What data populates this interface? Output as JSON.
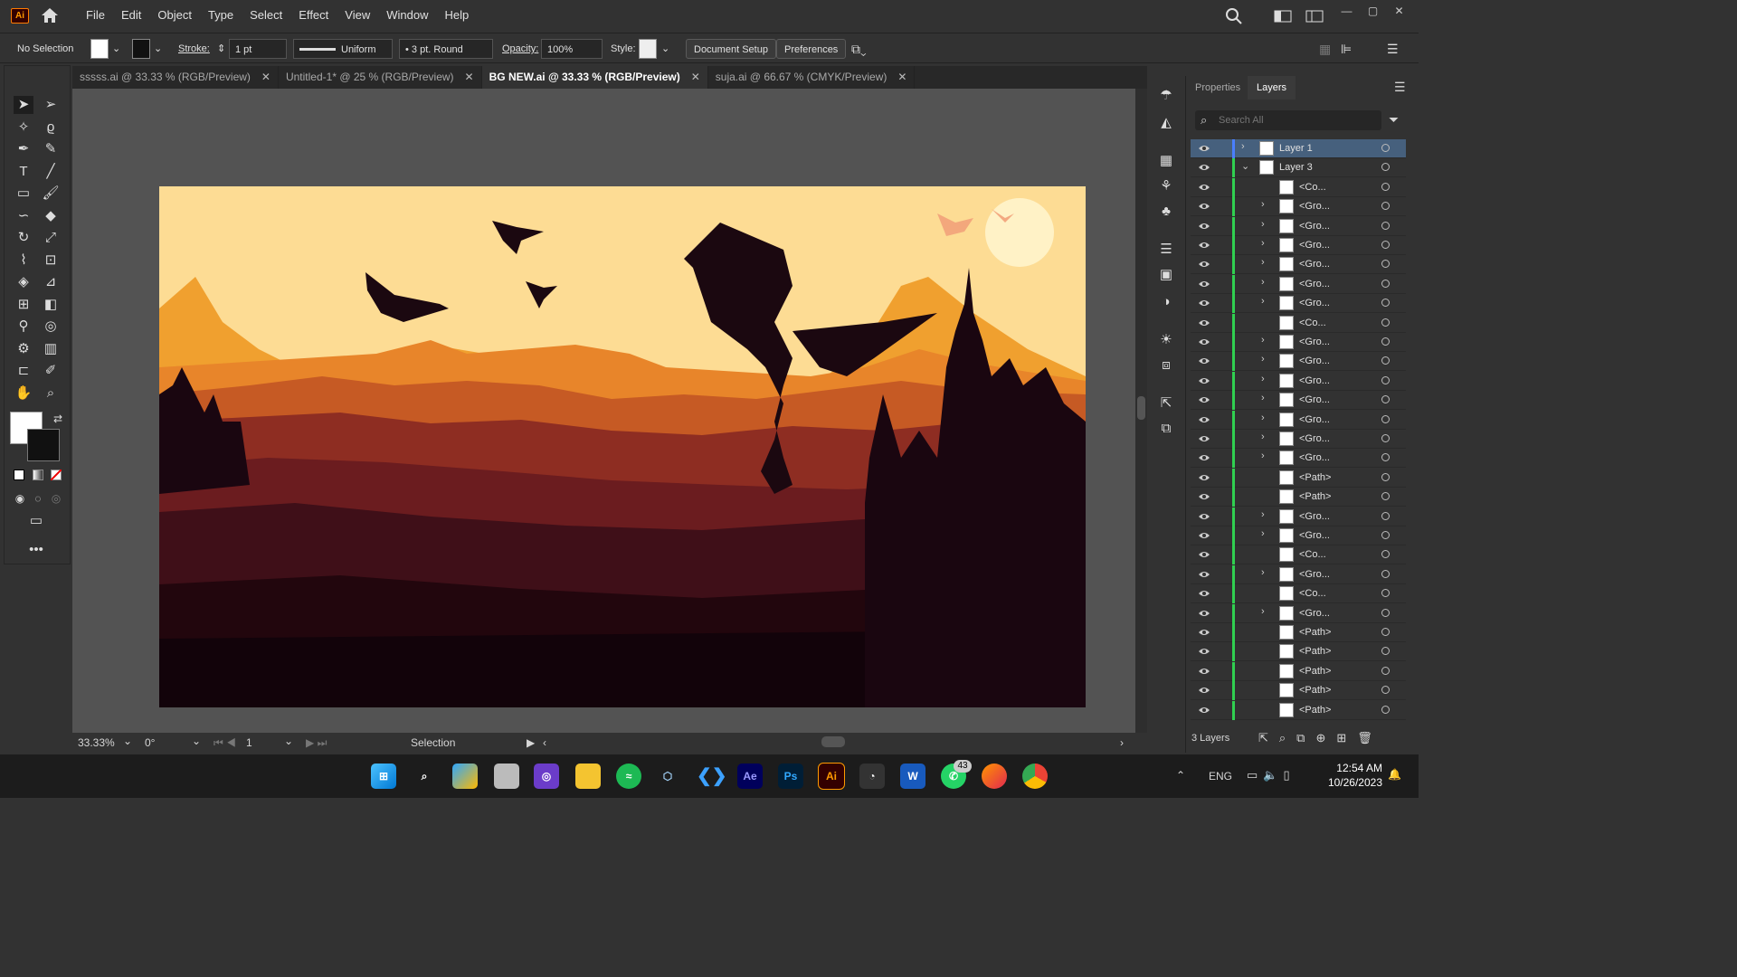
{
  "app": {
    "logo": "Ai",
    "window_controls": [
      "—",
      "▢",
      "✕"
    ]
  },
  "menu": [
    "File",
    "Edit",
    "Object",
    "Type",
    "Select",
    "Effect",
    "View",
    "Window",
    "Help"
  ],
  "control": {
    "selection": "No Selection",
    "stroke_label": "Stroke:",
    "stroke_value": "1 pt",
    "profile": "Uniform",
    "brush": "3 pt. Round",
    "opacity_label": "Opacity:",
    "opacity_value": "100%",
    "style_label": "Style:",
    "doc_setup": "Document Setup",
    "preferences": "Preferences"
  },
  "tabs": [
    {
      "label": "sssss.ai @ 33.33 % (RGB/Preview)",
      "close": "✕"
    },
    {
      "label": "Untitled-1* @ 25 % (RGB/Preview)",
      "close": "✕"
    },
    {
      "label": "BG NEW.ai @ 33.33 % (RGB/Preview)",
      "close": "✕",
      "active": true
    },
    {
      "label": "suja.ai @ 66.67 % (CMYK/Preview)",
      "close": "✕"
    }
  ],
  "status": {
    "zoom": "33.33%",
    "rotation": "0°",
    "artboard": "1",
    "tool": "Selection"
  },
  "panel": {
    "tabs": [
      "Properties",
      "Layers"
    ],
    "search_placeholder": "Search All",
    "footer": "3 Layers",
    "layers": [
      {
        "name": "Layer 1",
        "top": true,
        "expand": "›",
        "selected": true
      },
      {
        "name": "Layer 3",
        "top": true,
        "expand": "⌄"
      },
      {
        "name": "<Co...",
        "expand": ""
      },
      {
        "name": "<Gro...",
        "expand": "›"
      },
      {
        "name": "<Gro...",
        "expand": "›"
      },
      {
        "name": "<Gro...",
        "expand": "›"
      },
      {
        "name": "<Gro...",
        "expand": "›"
      },
      {
        "name": "<Gro...",
        "expand": "›"
      },
      {
        "name": "<Gro...",
        "expand": "›"
      },
      {
        "name": "<Co...",
        "expand": ""
      },
      {
        "name": "<Gro...",
        "expand": "›"
      },
      {
        "name": "<Gro...",
        "expand": "›"
      },
      {
        "name": "<Gro...",
        "expand": "›"
      },
      {
        "name": "<Gro...",
        "expand": "›"
      },
      {
        "name": "<Gro...",
        "expand": "›"
      },
      {
        "name": "<Gro...",
        "expand": "›"
      },
      {
        "name": "<Gro...",
        "expand": "›"
      },
      {
        "name": "<Path>",
        "expand": ""
      },
      {
        "name": "<Path>",
        "expand": ""
      },
      {
        "name": "<Gro...",
        "expand": "›"
      },
      {
        "name": "<Gro...",
        "expand": "›"
      },
      {
        "name": "<Co...",
        "expand": ""
      },
      {
        "name": "<Gro...",
        "expand": "›"
      },
      {
        "name": "<Co...",
        "expand": ""
      },
      {
        "name": "<Gro...",
        "expand": "›"
      },
      {
        "name": "<Path>",
        "expand": ""
      },
      {
        "name": "<Path>",
        "expand": ""
      },
      {
        "name": "<Path>",
        "expand": ""
      },
      {
        "name": "<Path>",
        "expand": ""
      },
      {
        "name": "<Path>",
        "expand": ""
      }
    ]
  },
  "taskbar": {
    "apps": [
      "start",
      "search",
      "copilot",
      "files",
      "photos",
      "explorer",
      "spotify",
      "virtualbox",
      "vscode",
      "Ae",
      "Ps",
      "Ai",
      "davinci",
      "W",
      "whatsapp",
      "firefox",
      "chrome"
    ],
    "whatsapp_badge": "43",
    "lang": "ENG",
    "time": "12:54 AM",
    "date": "10/26/2023"
  }
}
